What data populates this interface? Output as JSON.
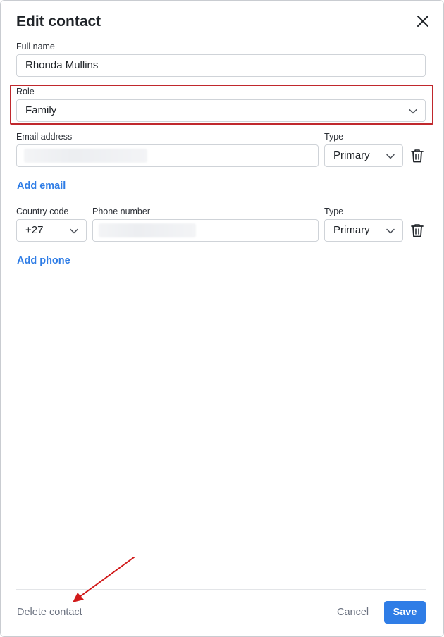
{
  "dialog": {
    "title": "Edit contact",
    "close_icon": "close-icon"
  },
  "full_name": {
    "label": "Full name",
    "value": "Rhonda Mullins"
  },
  "role": {
    "label": "Role",
    "value": "Family",
    "highlight_color": "#c0282d"
  },
  "email": {
    "label": "Email address",
    "type_label": "Type",
    "type_value": "Primary",
    "add_label": "Add email"
  },
  "phone": {
    "country_label": "Country code",
    "country_value": "+27",
    "number_label": "Phone number",
    "type_label": "Type",
    "type_value": "Primary",
    "add_label": "Add phone"
  },
  "footer": {
    "delete_label": "Delete contact",
    "cancel_label": "Cancel",
    "save_label": "Save"
  },
  "colors": {
    "accent": "#2f7de6",
    "annotation_arrow": "#d11a1a"
  }
}
